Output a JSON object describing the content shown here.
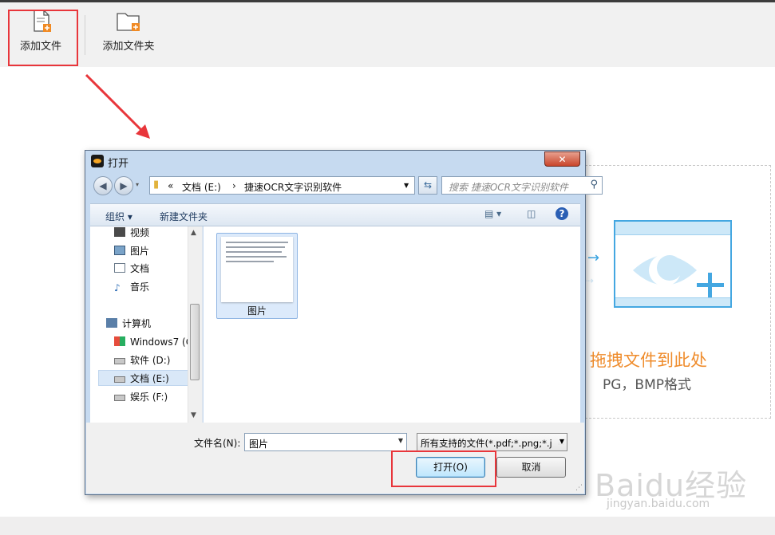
{
  "toolbar": {
    "add_file": "添加文件",
    "add_folder": "添加文件夹"
  },
  "drop_zone": {
    "main_text": "拖拽文件到此处",
    "visible_main": "拖拽文件到此处",
    "sub_text": "PG，BMP格式"
  },
  "watermark": {
    "brand": "Baidu经验",
    "url": "jingyan.baidu.com"
  },
  "dialog": {
    "title": "打开",
    "close": "✕",
    "address": {
      "prefix": "«",
      "segment1": "文档 (E:)",
      "separator": "›",
      "segment2": "捷速OCR文字识别软件"
    },
    "search_placeholder": "搜索 捷速OCR文字识别软件",
    "commands": {
      "organize": "组织 ▾",
      "new_folder": "新建文件夹"
    },
    "nav_items": [
      {
        "label": "视频"
      },
      {
        "label": "图片"
      },
      {
        "label": "文档"
      },
      {
        "label": "音乐"
      },
      {
        "label": "计算机"
      },
      {
        "label": "Windows7 (C"
      },
      {
        "label": "软件 (D:)"
      },
      {
        "label": "文档 (E:)"
      },
      {
        "label": "娱乐 (F:)"
      }
    ],
    "file": {
      "name": "图片"
    },
    "filename_label": "文件名(N):",
    "filename_value": "图片",
    "filetype_value": "所有支持的文件(*.pdf;*.png;*.j",
    "open_button": "打开(O)",
    "cancel_button": "取消"
  },
  "colors": {
    "highlight_red": "#e8363b",
    "accent_orange": "#ef8c2c",
    "accent_blue": "#44a7e1"
  }
}
